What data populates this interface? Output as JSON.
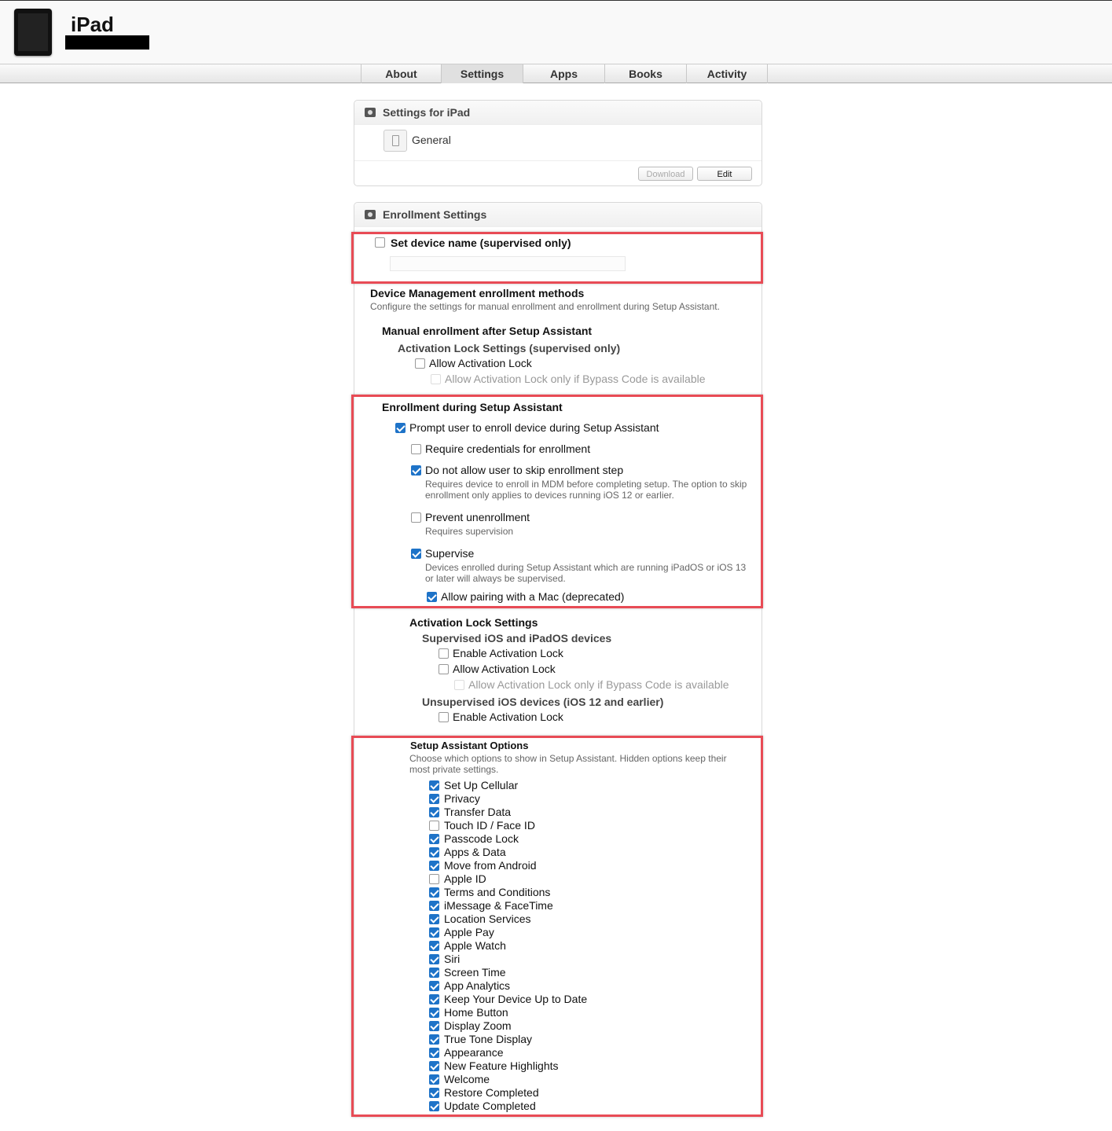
{
  "header": {
    "title": "iPad"
  },
  "tabs": [
    {
      "label": "About",
      "active": false
    },
    {
      "label": "Settings",
      "active": true
    },
    {
      "label": "Apps",
      "active": false
    },
    {
      "label": "Books",
      "active": false
    },
    {
      "label": "Activity",
      "active": false
    }
  ],
  "settings_panel": {
    "title": "Settings for iPad",
    "item": "General",
    "download_label": "Download",
    "edit_label": "Edit"
  },
  "enrollment": {
    "title": "Enrollment Settings",
    "set_device_name": {
      "label": "Set device name (supervised only)",
      "checked": false,
      "value": ""
    },
    "dm_methods": {
      "title": "Device Management enrollment methods",
      "desc": "Configure the settings for manual enrollment and enrollment during Setup Assistant."
    },
    "manual": {
      "title": "Manual enrollment after Setup Assistant",
      "activation_title": "Activation Lock Settings (supervised only)",
      "allow_activation_lock": "Allow Activation Lock",
      "allow_bypass": "Allow Activation Lock only if Bypass Code is available"
    },
    "during": {
      "title": "Enrollment during Setup Assistant",
      "prompt": "Prompt user to enroll device during Setup Assistant",
      "require_credentials": "Require credentials for enrollment",
      "no_skip": "Do not allow user to skip enrollment step",
      "no_skip_desc": "Requires device to enroll in MDM before completing setup. The option to skip enrollment only applies to devices running iOS 12 or earlier.",
      "prevent_unenroll": "Prevent unenrollment",
      "prevent_unenroll_desc": "Requires supervision",
      "supervise": "Supervise",
      "supervise_desc": "Devices enrolled during Setup Assistant which are running iPadOS or iOS 13 or later will always be supervised.",
      "pairing": "Allow pairing with a Mac (deprecated)"
    },
    "activation_lock": {
      "title": "Activation Lock Settings",
      "supervised_title": "Supervised iOS and iPadOS devices",
      "enable": "Enable Activation Lock",
      "allow": "Allow Activation Lock",
      "bypass": "Allow Activation Lock only if Bypass Code is available",
      "unsupervised_title": "Unsupervised iOS devices (iOS 12 and earlier)",
      "enable2": "Enable Activation Lock"
    },
    "setup_assistant": {
      "title": "Setup Assistant Options",
      "desc": "Choose which options to show in Setup Assistant. Hidden options keep their most private settings.",
      "items": [
        {
          "label": "Set Up Cellular",
          "checked": true
        },
        {
          "label": "Privacy",
          "checked": true
        },
        {
          "label": "Transfer Data",
          "checked": true
        },
        {
          "label": "Touch ID / Face ID",
          "checked": false
        },
        {
          "label": "Passcode Lock",
          "checked": true
        },
        {
          "label": "Apps & Data",
          "checked": true
        },
        {
          "label": "Move from Android",
          "checked": true
        },
        {
          "label": "Apple ID",
          "checked": false
        },
        {
          "label": "Terms and Conditions",
          "checked": true
        },
        {
          "label": "iMessage & FaceTime",
          "checked": true
        },
        {
          "label": "Location Services",
          "checked": true
        },
        {
          "label": "Apple Pay",
          "checked": true
        },
        {
          "label": "Apple Watch",
          "checked": true
        },
        {
          "label": "Siri",
          "checked": true
        },
        {
          "label": "Screen Time",
          "checked": true
        },
        {
          "label": "App Analytics",
          "checked": true
        },
        {
          "label": "Keep Your Device Up to Date",
          "checked": true
        },
        {
          "label": "Home Button",
          "checked": true
        },
        {
          "label": "Display Zoom",
          "checked": true
        },
        {
          "label": "True Tone Display",
          "checked": true
        },
        {
          "label": "Appearance",
          "checked": true
        },
        {
          "label": "New Feature Highlights",
          "checked": true
        },
        {
          "label": "Welcome",
          "checked": true
        },
        {
          "label": "Restore Completed",
          "checked": true
        },
        {
          "label": "Update Completed",
          "checked": true
        }
      ]
    }
  },
  "colors": {
    "highlight": "#e84b55",
    "check": "#1e73c8"
  }
}
